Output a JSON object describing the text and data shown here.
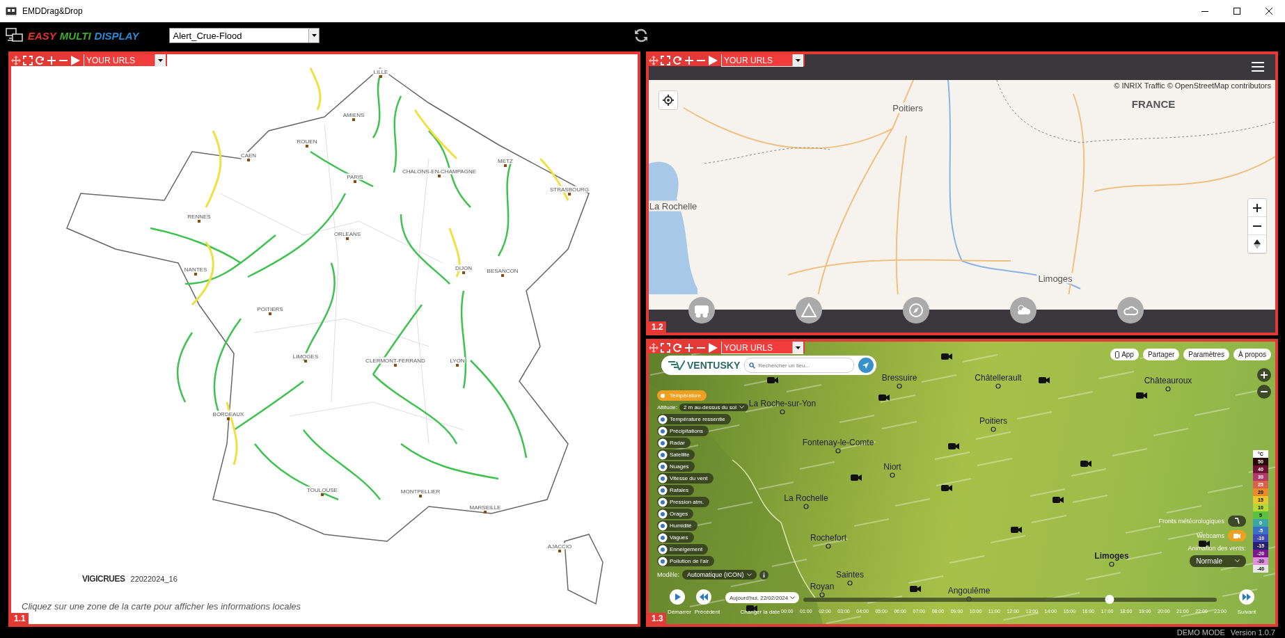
{
  "window": {
    "title": "EMDDrag&Drop"
  },
  "app_bar": {
    "logo_words": [
      {
        "text": "EASY",
        "color": "#e8322d"
      },
      {
        "text": "MULTI",
        "color": "#3fae2a"
      },
      {
        "text": "DISPLAY",
        "color": "#2b8ad8"
      }
    ],
    "profile_select": "Alert_Crue-Flood"
  },
  "panels": [
    {
      "kind": "vigicrues",
      "label": "1.1",
      "url_select": "YOUR URLS",
      "cities": [
        "LILLE",
        "AMIENS",
        "ROUEN",
        "CAEN",
        "PARIS",
        "CHALONS-EN-CHAMPAGNE",
        "METZ",
        "STRASBOURG",
        "RENNES",
        "ORLEANS",
        "NANTES",
        "DIJON",
        "BESANCON",
        "POITIERS",
        "LIMOGES",
        "CLERMONT-FERRAND",
        "LYON",
        "BORDEAUX",
        "TOULOUSE",
        "MONTPELLIER",
        "MARSEILLE",
        "AJACCIO"
      ],
      "brand": "VIGICRUES",
      "date": "22022024_16",
      "hint": "Cliquez sur une zone de la carte pour afficher les informations locales"
    },
    {
      "kind": "traffic",
      "label": "1.2",
      "url_select": "YOUR URLS",
      "attribution": "© INRIX Traffic © OpenStreetMap contributors",
      "places": [
        "Poitiers",
        "FRANCE",
        "La Rochelle",
        "Limoges"
      ]
    },
    {
      "kind": "ventusky",
      "label": "1.3",
      "url_select": "YOUR URLS",
      "logo": "VENTUSKY",
      "search_placeholder": "Rechercher un lieu...",
      "top_buttons": [
        "App",
        "Partager",
        "Paramètres",
        "À propos"
      ],
      "places": [
        "Bressuire",
        "Châtellerault",
        "Châteauroux",
        "La Roche-sur-Yon",
        "Poitiers",
        "Fontenay-le-Comte",
        "Niort",
        "La Rochelle",
        "Rochefort",
        "Saintes",
        "Royan",
        "Angoulême",
        "Limoges"
      ],
      "altitude_label": "Altitude:",
      "altitude_value": "2 m au-dessus du sol",
      "layers": [
        {
          "label": "Température",
          "selected": true
        },
        {
          "label": "Température ressentie",
          "selected": false
        },
        {
          "label": "Précipitations",
          "selected": false
        },
        {
          "label": "Radar",
          "selected": false
        },
        {
          "label": "Satellite",
          "selected": false
        },
        {
          "label": "Nuages",
          "selected": false
        },
        {
          "label": "Vitesse du vent",
          "selected": false
        },
        {
          "label": "Rafales",
          "selected": false
        },
        {
          "label": "Pression atm.",
          "selected": false
        },
        {
          "label": "Orages",
          "selected": false
        },
        {
          "label": "Humidité",
          "selected": false
        },
        {
          "label": "Vagues",
          "selected": false
        },
        {
          "label": "Enneigement",
          "selected": false
        },
        {
          "label": "Pollution de l'air",
          "selected": false
        }
      ],
      "model_label": "Modèle:",
      "model_value": "Automatique (ICON)",
      "legend": {
        "unit": "°C",
        "steps": [
          {
            "label": "50",
            "color": "#2b0707"
          },
          {
            "label": "40",
            "color": "#6e1030"
          },
          {
            "label": "30",
            "color": "#b03a6a"
          },
          {
            "label": "25",
            "color": "#d8624a"
          },
          {
            "label": "20",
            "color": "#e88a2a"
          },
          {
            "label": "15",
            "color": "#e8c830"
          },
          {
            "label": "10",
            "color": "#b8d838"
          },
          {
            "label": "5",
            "color": "#5cc040"
          },
          {
            "label": "0",
            "color": "#3aa8a0"
          },
          {
            "label": "-5",
            "color": "#3a70c8"
          },
          {
            "label": "-10",
            "color": "#4048b8"
          },
          {
            "label": "-15",
            "color": "#2a2070"
          },
          {
            "label": "-20",
            "color": "#7a1890"
          },
          {
            "label": "-30",
            "color": "#e090e0"
          },
          {
            "label": "-40",
            "color": "#e8e8e8"
          }
        ]
      },
      "fronts": {
        "label": "Fronts météorologiques",
        "on": false
      },
      "webcams": {
        "label": "Webcams",
        "on": true
      },
      "wind_animation": {
        "label": "Animation des vents:",
        "value": "Normale"
      },
      "controls": {
        "play": "Démarrer",
        "previous": "Précédent",
        "date": "Aujourd'hui, 22/02/2024",
        "change_date": "Changer la date",
        "next": "Suivant"
      },
      "timeline": {
        "hours": [
          "00:00",
          "01:00",
          "02:00",
          "03:00",
          "04:00",
          "05:00",
          "06:00",
          "07:00",
          "08:00",
          "09:00",
          "10:00",
          "11:00",
          "12:00",
          "13:00",
          "14:00",
          "15:00",
          "16:00",
          "17:00",
          "18:00",
          "19:00",
          "20:00",
          "21:00",
          "22:00",
          "23:00"
        ],
        "level": 0.74
      }
    }
  ],
  "footer": {
    "mode": "DEMO MODE",
    "version": "Version 1.0.7"
  }
}
